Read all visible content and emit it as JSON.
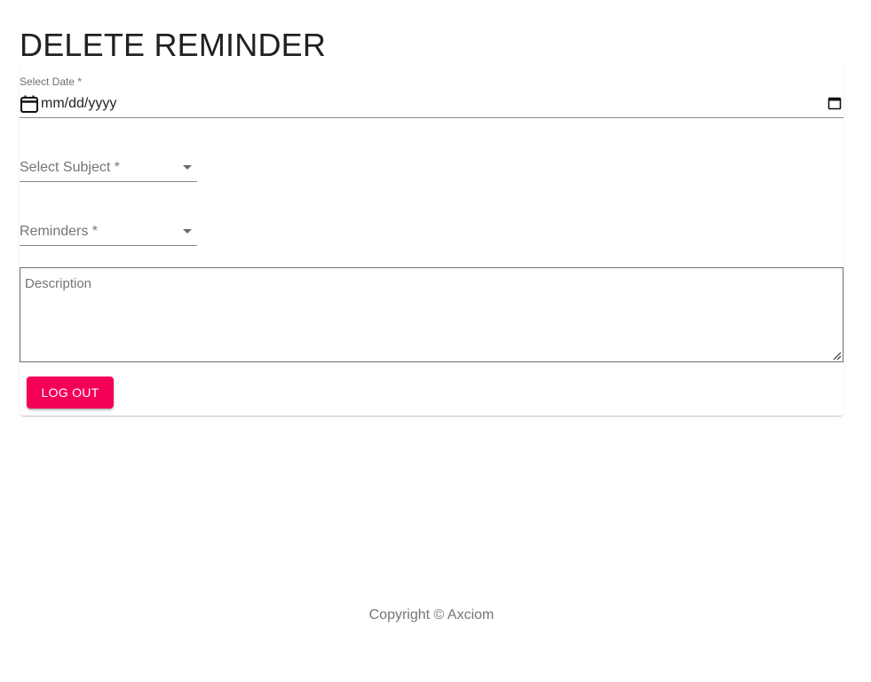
{
  "page": {
    "title": "DELETE REMINDER"
  },
  "form": {
    "date_label": "Select Date *",
    "date_value": "mm/dd/yyyy",
    "subject_label": "Select Subject *",
    "reminders_label": "Reminders *",
    "description_placeholder": "Description",
    "logout_label": "LOG OUT"
  },
  "footer": {
    "copyright": "Copyright © Axciom"
  },
  "colors": {
    "accent": "#f50057",
    "text_primary": "#212121",
    "text_secondary": "#757575"
  },
  "icons": {
    "date_left": "calendar-icon",
    "date_right": "calendar-picker-icon",
    "select_caret": "caret-down-icon",
    "textarea_resize": "resize-handle-icon"
  }
}
